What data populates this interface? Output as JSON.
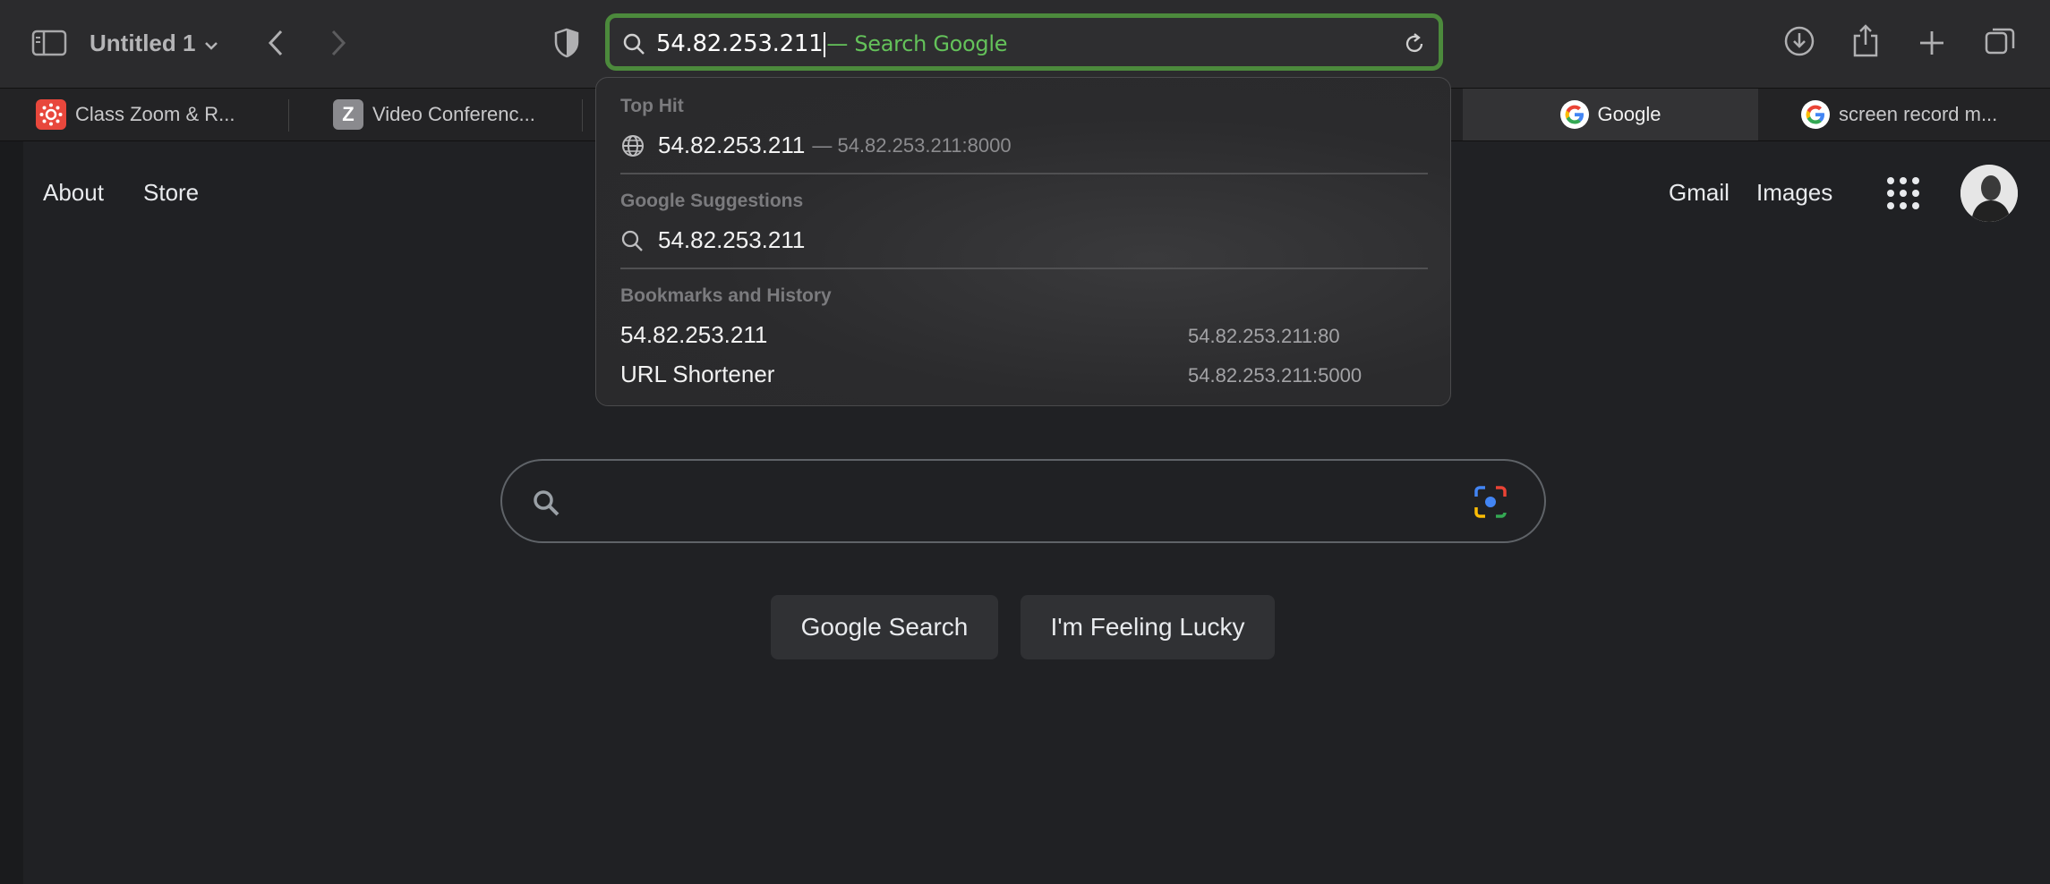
{
  "toolbar": {
    "window_title": "Untitled 1",
    "address_typed": "54.82.253.211",
    "address_hint": "— Search Google"
  },
  "tabs": [
    {
      "label": "Class Zoom & R...",
      "favicon": "canvas-icon"
    },
    {
      "label": "Video Conferenc...",
      "favicon": "z-icon",
      "favicon_letter": "Z"
    },
    {
      "label": "Google",
      "favicon": "google-g-icon",
      "active": true
    },
    {
      "label": "screen record m...",
      "favicon": "google-g-icon"
    }
  ],
  "dropdown": {
    "top_hit": {
      "title": "Top Hit",
      "address": "54.82.253.211",
      "detail": "— 54.82.253.211:8000"
    },
    "suggestions": {
      "title": "Google Suggestions",
      "items": [
        "54.82.253.211"
      ]
    },
    "history": {
      "title": "Bookmarks and History",
      "items": [
        {
          "title": "54.82.253.211",
          "url": "54.82.253.211:80"
        },
        {
          "title": "URL Shortener",
          "url": "54.82.253.211:5000"
        }
      ]
    }
  },
  "google": {
    "links_left": [
      "About",
      "Store"
    ],
    "links_right": [
      "Gmail",
      "Images"
    ],
    "search_button": "Google Search",
    "lucky_button": "I'm Feeling Lucky"
  },
  "colors": {
    "url_border": "#4c8a3c",
    "url_hint": "#64c25a",
    "page_bg": "#202124",
    "button_bg": "#303134"
  }
}
